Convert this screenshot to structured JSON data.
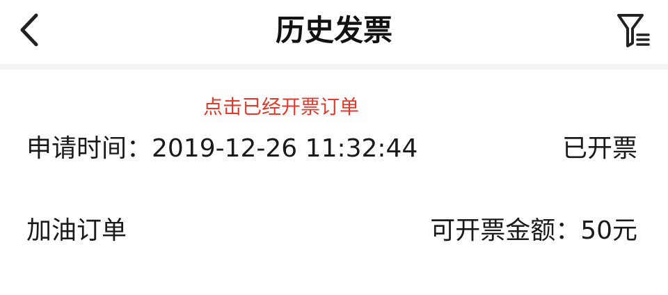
{
  "header": {
    "title": "历史发票",
    "back_icon": "chevron-left-icon",
    "filter_icon": "filter-icon"
  },
  "annotation": {
    "text": "点击已经开票订单",
    "color": "#e23a2a"
  },
  "invoice": {
    "apply_time": "申请时间：2019-12-26 11:32:44",
    "status": "已开票",
    "order_type": "加油订单",
    "amount": "可开票金额：50元"
  }
}
